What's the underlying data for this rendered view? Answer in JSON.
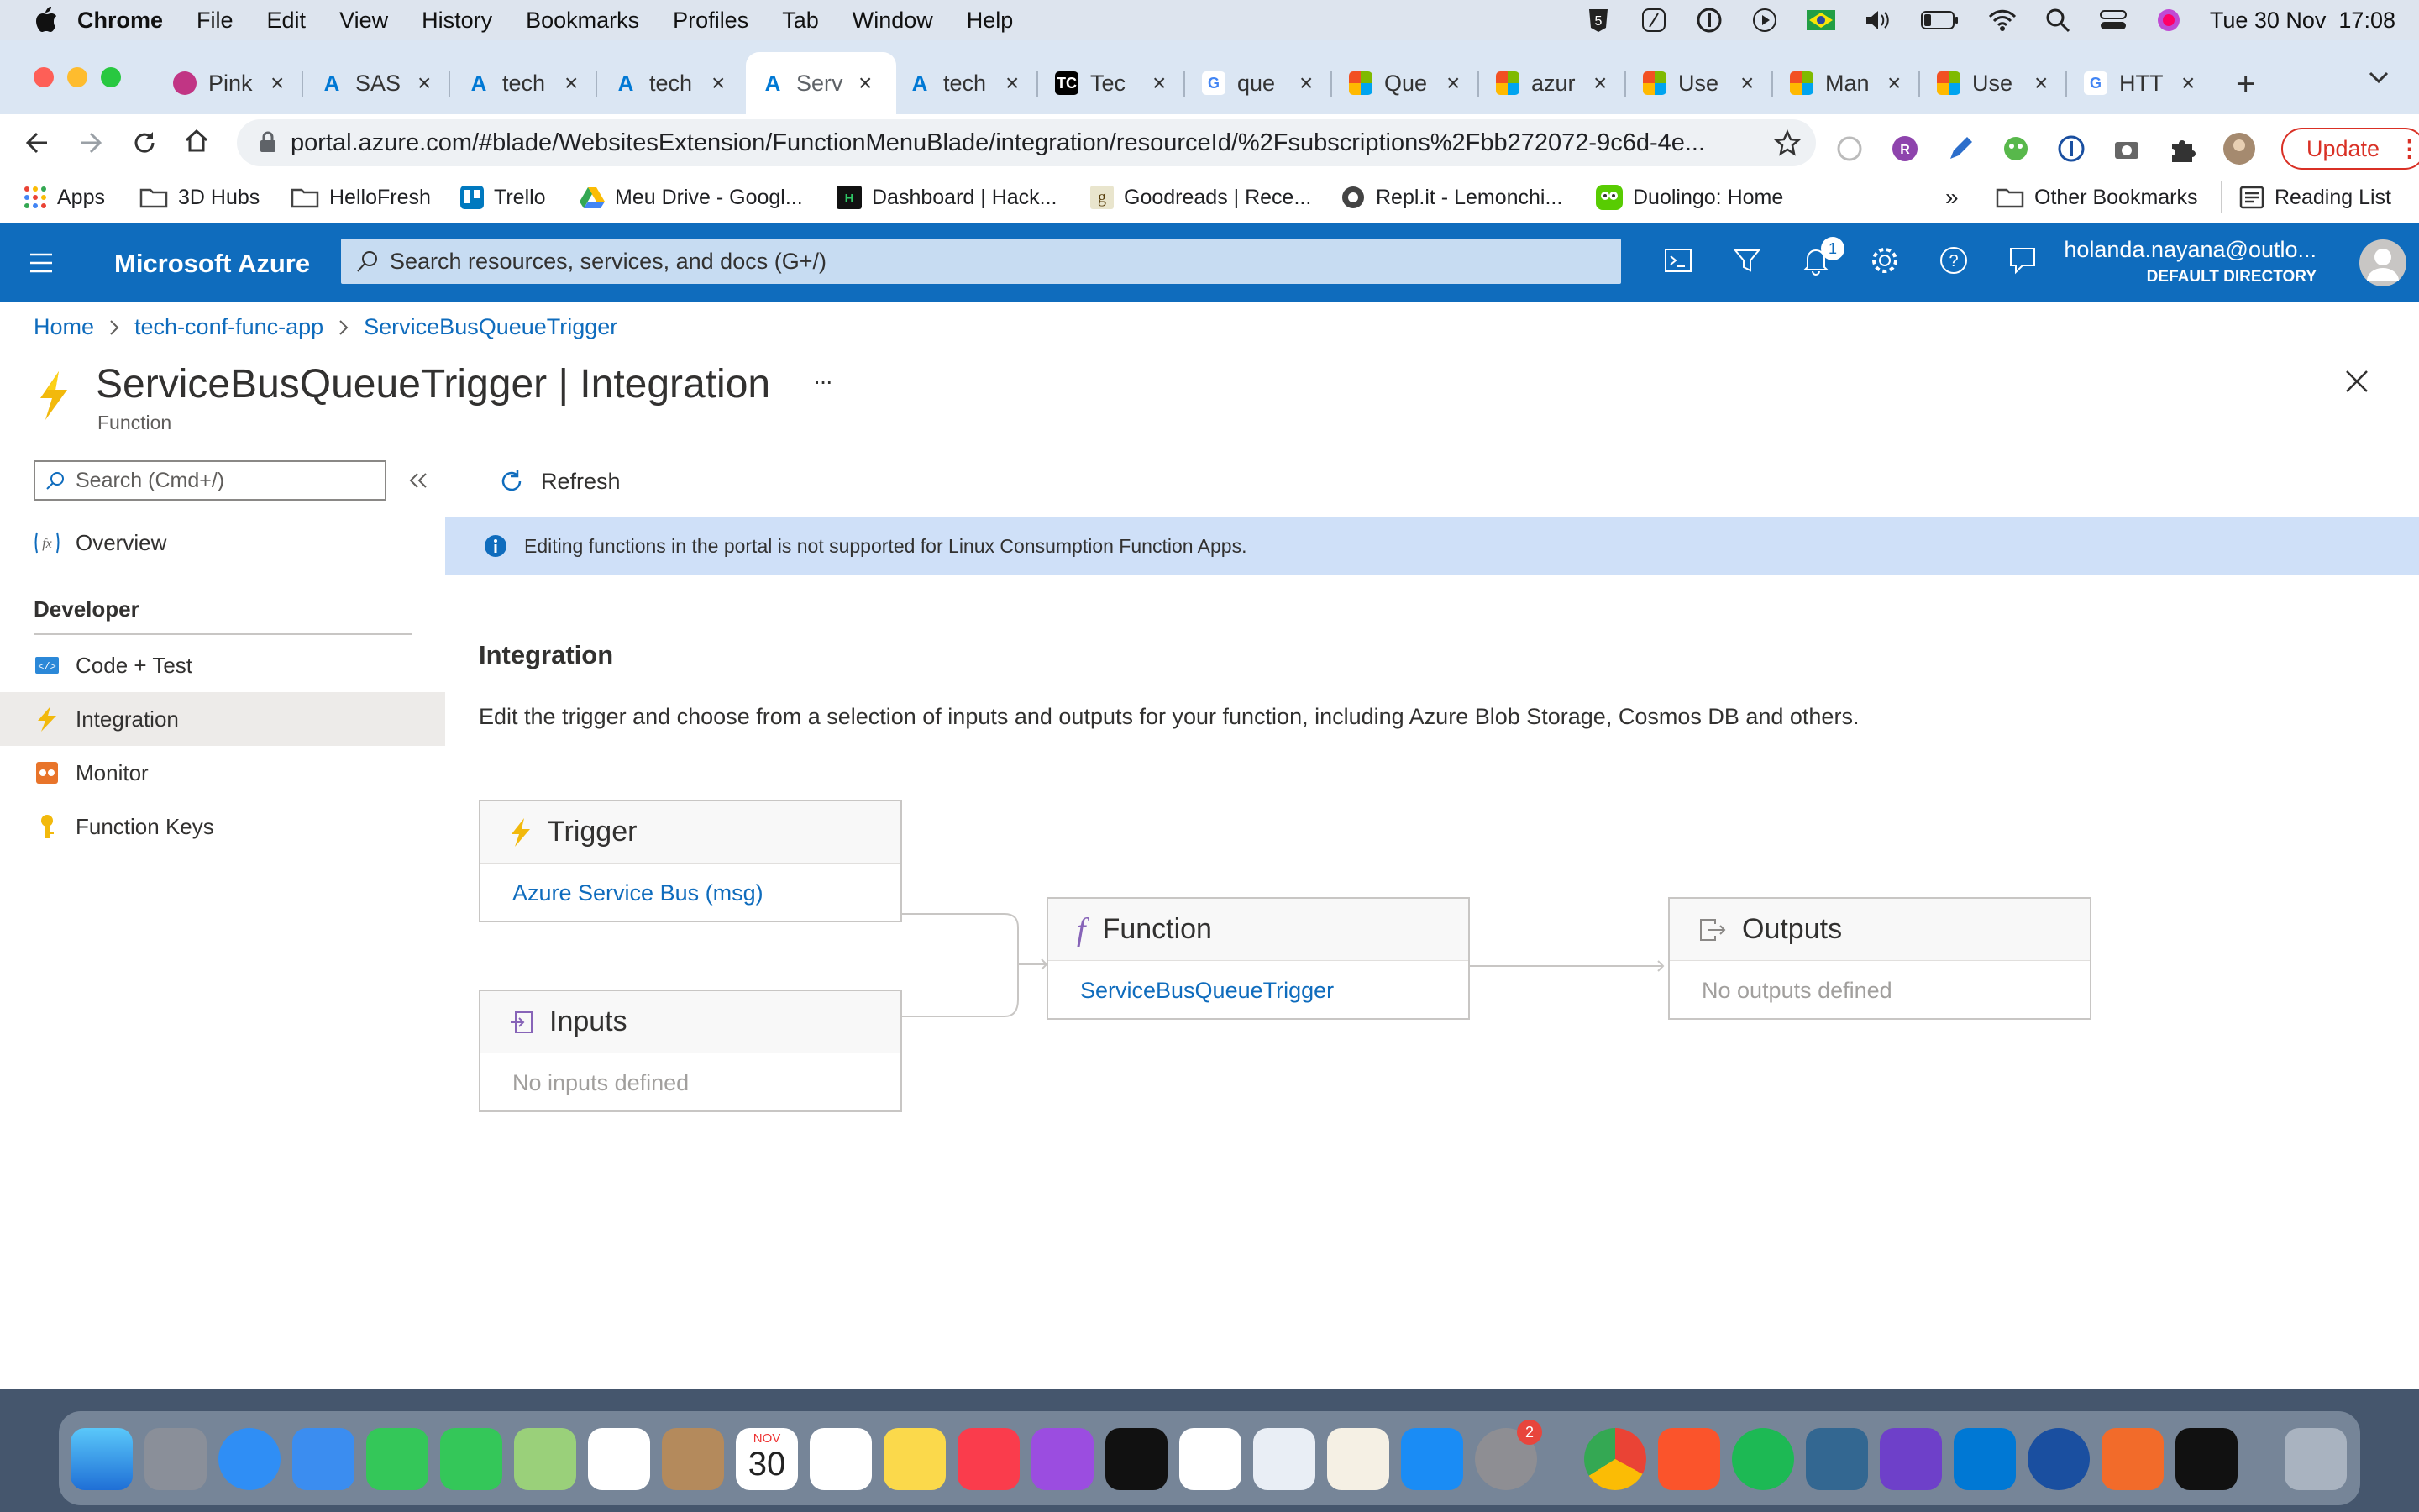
{
  "menubar": {
    "app": "Chrome",
    "items": [
      "File",
      "Edit",
      "View",
      "History",
      "Bookmarks",
      "Profiles",
      "Tab",
      "Window",
      "Help"
    ],
    "datetime": "Tue 30 Nov  17:08"
  },
  "browser": {
    "tabs": [
      {
        "label": "Pink",
        "color": "#c13584"
      },
      {
        "label": "SAS",
        "color": "#0078d4"
      },
      {
        "label": "tech",
        "color": "#0078d4"
      },
      {
        "label": "tech",
        "color": "#0078d4"
      },
      {
        "label": "Serv",
        "color": "#0078d4",
        "active": true
      },
      {
        "label": "tech",
        "color": "#0078d4"
      },
      {
        "label": "Tec",
        "color": "#000000",
        "glyph": "TC"
      },
      {
        "label": "que",
        "color": "#4285f4",
        "glyph": "G"
      },
      {
        "label": "Que",
        "color": "#f25022"
      },
      {
        "label": "azur",
        "color": "#f25022"
      },
      {
        "label": "Use",
        "color": "#f25022"
      },
      {
        "label": "Man",
        "color": "#f25022"
      },
      {
        "label": "Use",
        "color": "#f25022"
      },
      {
        "label": "HTT",
        "color": "#4285f4",
        "glyph": "G"
      }
    ],
    "url": "portal.azure.com/#blade/WebsitesExtension/FunctionMenuBlade/integration/resourceId/%2Fsubscriptions%2Fbb272072-9c6d-4e...",
    "update_label": "Update",
    "bookmarks": [
      {
        "label": "Apps"
      },
      {
        "label": "3D Hubs"
      },
      {
        "label": "HelloFresh"
      },
      {
        "label": "Trello"
      },
      {
        "label": "Meu Drive - Googl..."
      },
      {
        "label": "Dashboard | Hack..."
      },
      {
        "label": "Goodreads | Rece..."
      },
      {
        "label": "Repl.it - Lemonchi..."
      },
      {
        "label": "Duolingo: Home"
      }
    ],
    "bookmarks_more": "»",
    "other_bookmarks": "Other Bookmarks",
    "reading_list": "Reading List"
  },
  "azure": {
    "brand": "Microsoft Azure",
    "search_placeholder": "Search resources, services, and docs (G+/)",
    "notification_count": "1",
    "user_email": "holanda.nayana@outlo...",
    "user_directory": "DEFAULT DIRECTORY"
  },
  "breadcrumb": [
    "Home",
    "tech-conf-func-app",
    "ServiceBusQueueTrigger"
  ],
  "blade": {
    "title": "ServiceBusQueueTrigger | Integration",
    "subtitle": "Function",
    "more": "···"
  },
  "sidebar": {
    "search_placeholder": "Search (Cmd+/)",
    "overview": "Overview",
    "section": "Developer",
    "items": [
      "Code + Test",
      "Integration",
      "Monitor",
      "Function Keys"
    ]
  },
  "toolbar": {
    "refresh": "Refresh"
  },
  "info_banner": "Editing functions in the portal is not supported for Linux Consumption Function Apps.",
  "integration": {
    "heading": "Integration",
    "description": "Edit the trigger and choose from a selection of inputs and outputs for your function, including Azure Blob Storage, Cosmos DB and others.",
    "trigger": {
      "title": "Trigger",
      "value": "Azure Service Bus (msg)"
    },
    "inputs": {
      "title": "Inputs",
      "value": "No inputs defined"
    },
    "function": {
      "title": "Function",
      "value": "ServiceBusQueueTrigger"
    },
    "outputs": {
      "title": "Outputs",
      "value": "No outputs defined"
    }
  },
  "dock": {
    "calendar_month": "NOV",
    "calendar_day": "30",
    "settings_badge": "2"
  }
}
